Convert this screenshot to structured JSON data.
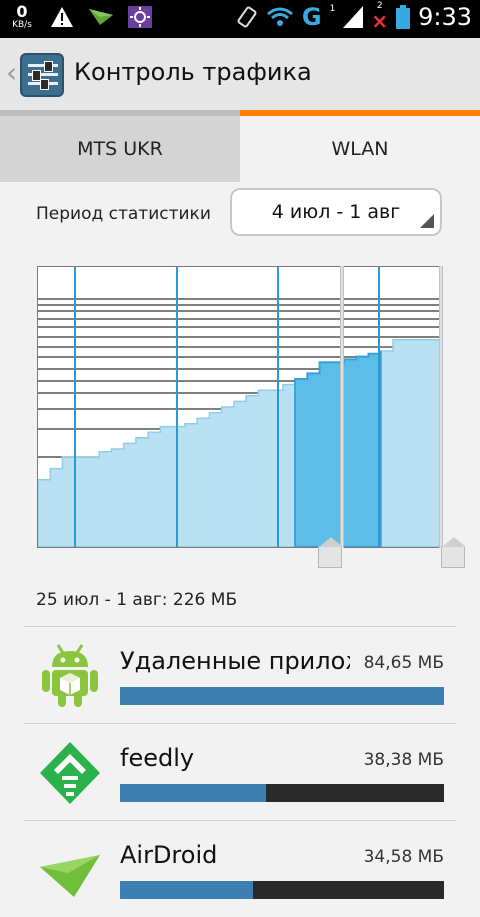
{
  "status_bar": {
    "speed_value": "0",
    "speed_unit": "KB/s",
    "sim2_label": "2",
    "sim1_label": "1",
    "network_type": "G",
    "time": "9:33"
  },
  "action_bar": {
    "title": "Контроль трафика",
    "icon": "settings-sliders-icon"
  },
  "tabs": [
    {
      "label": "MTS UKR",
      "selected": false
    },
    {
      "label": "WLAN",
      "selected": true
    }
  ],
  "period": {
    "label": "Период статистики",
    "selected_value": "4 июл - 1 авг"
  },
  "chart_data": {
    "type": "area",
    "title": "",
    "xlabel": "",
    "ylabel": "",
    "x_range_label": [
      "4 июл",
      "1 авг"
    ],
    "cumulative_fraction": [
      0.24,
      0.28,
      0.32,
      0.32,
      0.32,
      0.34,
      0.35,
      0.37,
      0.39,
      0.41,
      0.43,
      0.43,
      0.44,
      0.46,
      0.48,
      0.5,
      0.52,
      0.54,
      0.56,
      0.56,
      0.58,
      0.6,
      0.62,
      0.66,
      0.66,
      0.67,
      0.68,
      0.69,
      0.7,
      0.74,
      0.74,
      0.74,
      0.74,
      0.74
    ],
    "selected_range_start_index": 21,
    "selected_range_end_index": 28,
    "grid": true,
    "colors": {
      "unselected_fill": "#b9e1f3",
      "unselected_line": "#8fcde9",
      "selected_fill": "#5bbde8",
      "selected_line": "#37a2d8",
      "grid": "#000000",
      "vertical_grid": "#2a9bd6"
    }
  },
  "range_summary": "25 июл - 1 авг: 226 МБ",
  "apps": [
    {
      "name": "Удаленные приложения",
      "size": "84,65 МБ",
      "usage_fraction": 1.0,
      "icon": "android-robot-icon"
    },
    {
      "name": "feedly",
      "size": "38,38 МБ",
      "usage_fraction": 0.45,
      "icon": "feedly-icon"
    },
    {
      "name": "AirDroid",
      "size": "34,58 МБ",
      "usage_fraction": 0.41,
      "icon": "airdroid-icon"
    }
  ],
  "colors": {
    "accent_orange": "#ff7f00",
    "usage_bar": "#3d7fb0",
    "usage_bar_track": "#2a2a2a"
  }
}
